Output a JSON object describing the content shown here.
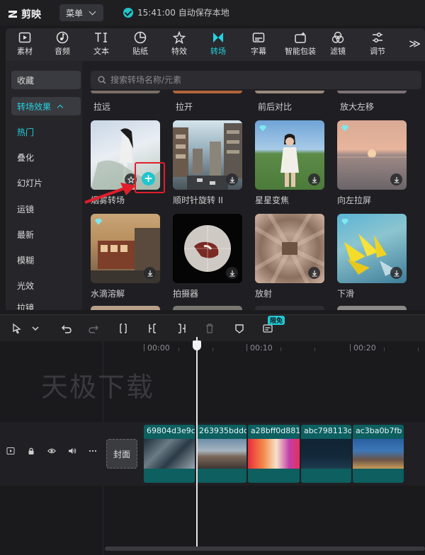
{
  "app": {
    "name": "剪映",
    "menu_label": "菜单",
    "autosave": "15:41:00 自动保存本地"
  },
  "tabs": [
    {
      "label": "素材",
      "icon": "media-icon"
    },
    {
      "label": "音频",
      "icon": "audio-icon"
    },
    {
      "label": "文本",
      "icon": "text-icon"
    },
    {
      "label": "贴纸",
      "icon": "sticker-icon"
    },
    {
      "label": "特效",
      "icon": "effects-icon"
    },
    {
      "label": "转场",
      "icon": "transition-icon",
      "active": true
    },
    {
      "label": "字幕",
      "icon": "subtitle-icon"
    },
    {
      "label": "智能包装",
      "icon": "smart-package-icon"
    },
    {
      "label": "滤镜",
      "icon": "filter-icon"
    },
    {
      "label": "调节",
      "icon": "adjust-icon"
    }
  ],
  "tabs_more": "≫",
  "sidebar": {
    "favorites": "收藏",
    "group": "转场效果",
    "items": [
      "热门",
      "叠化",
      "幻灯片",
      "运镜",
      "最新",
      "模糊",
      "光效",
      "拉镜"
    ]
  },
  "search": {
    "placeholder": "搜索转场名称/元素"
  },
  "top_row": [
    "拉远",
    "拉开",
    "前后对比",
    "放大左移"
  ],
  "cards": [
    {
      "label": "烟雾转场"
    },
    {
      "label": "顺时针旋转 II"
    },
    {
      "label": "星星变焦"
    },
    {
      "label": "向左拉屏"
    },
    {
      "label": "水滴溶解"
    },
    {
      "label": "拍摄器"
    },
    {
      "label": "放射"
    },
    {
      "label": "下滑"
    }
  ],
  "toolbar": {
    "free_badge": "限免"
  },
  "timeline": {
    "ticks": [
      "00:00",
      "00:10",
      "00:20"
    ],
    "watermark": "天极下载",
    "cover_label": "封面",
    "clips": [
      "69804d3e9c",
      "263935bddc",
      "a28bff0d881",
      "abc798113d",
      "ac3ba0b7fb"
    ]
  },
  "colors": {
    "accent": "#22d3e0",
    "highlight": "#e21e2b",
    "clip": "#0d5f60"
  }
}
